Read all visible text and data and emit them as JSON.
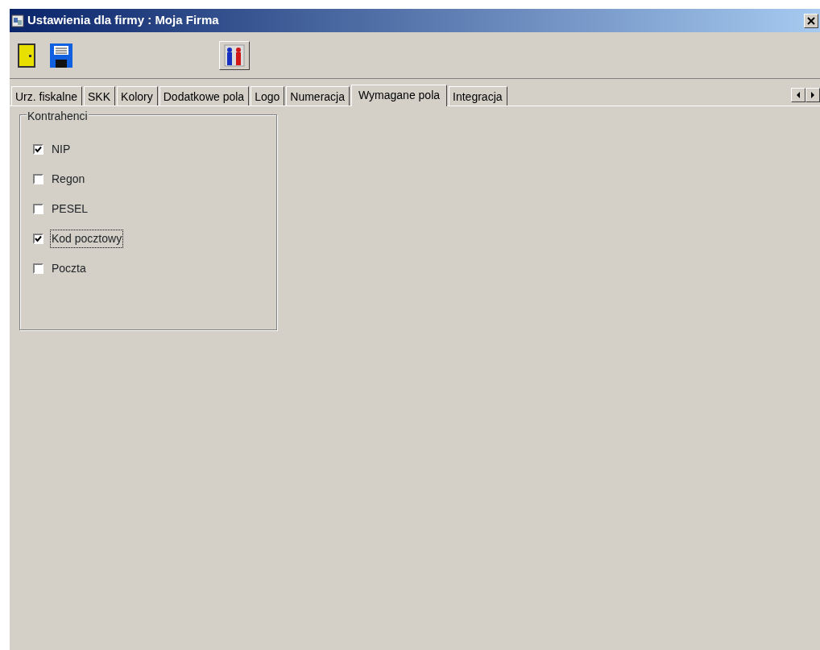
{
  "window": {
    "title": "Ustawienia dla firmy  : Moja Firma"
  },
  "tabs": [
    {
      "label": "Urz. fiskalne",
      "selected": false
    },
    {
      "label": "SKK",
      "selected": false
    },
    {
      "label": "Kolory",
      "selected": false
    },
    {
      "label": "Dodatkowe pola",
      "selected": false
    },
    {
      "label": "Logo",
      "selected": false
    },
    {
      "label": "Numeracja",
      "selected": false
    },
    {
      "label": "Wymagane pola",
      "selected": true
    },
    {
      "label": "Integracja",
      "selected": false
    }
  ],
  "group": {
    "title": "Kontrahenci",
    "items": [
      {
        "label": "NIP",
        "checked": true,
        "focused": false
      },
      {
        "label": "Regon",
        "checked": false,
        "focused": false
      },
      {
        "label": "PESEL",
        "checked": false,
        "focused": false
      },
      {
        "label": "Kod pocztowy",
        "checked": true,
        "focused": true
      },
      {
        "label": "Poczta",
        "checked": false,
        "focused": false
      }
    ]
  }
}
